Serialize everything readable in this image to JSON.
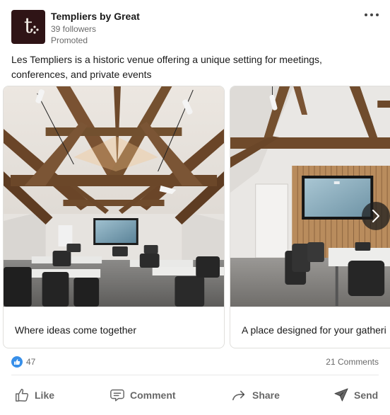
{
  "company": {
    "name": "Templiers by Great",
    "followers": "39 followers",
    "status": "Promoted",
    "logo_letter": "t"
  },
  "post": {
    "commentary": "Les Templiers is a historic venue offering a unique setting for meetings, conferences, and private events"
  },
  "carousel": {
    "cards": [
      {
        "title": "Where ideas come together"
      },
      {
        "title": "A place designed for your gatheri"
      }
    ]
  },
  "social": {
    "reactions_count": "47",
    "comments_count": "21 Comments"
  },
  "actions": {
    "like": "Like",
    "comment": "Comment",
    "share": "Share",
    "send": "Send"
  },
  "colors": {
    "logo_bg": "#2f1416",
    "reaction_blue": "#378fe9",
    "muted_text": "rgba(0,0,0,0.6)"
  },
  "icons": [
    "more-icon",
    "chevron-right-icon",
    "like-reaction-icon",
    "thumbs-up-icon",
    "comment-icon",
    "share-arrow-icon",
    "send-icon"
  ]
}
